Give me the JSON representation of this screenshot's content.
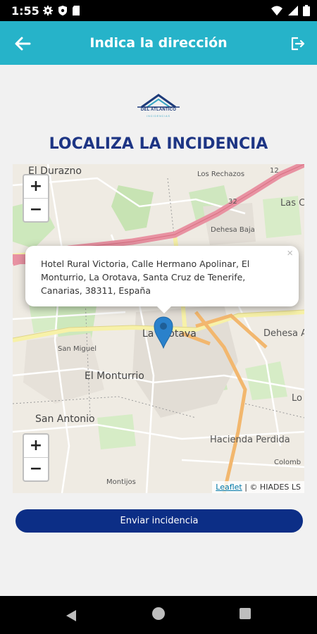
{
  "status_bar": {
    "time": "1:55",
    "icons": [
      "gear-icon",
      "shield-icon",
      "sd-card-icon",
      "wifi-icon",
      "signal-icon",
      "battery-icon"
    ]
  },
  "app_bar": {
    "title": "Indica la dirección",
    "back_icon": "arrow-left-icon",
    "logout_icon": "logout-icon",
    "color": "#26b3c9"
  },
  "logo": {
    "name": "DEL ATLÁNTICO",
    "tagline": "INCIDENCIAS"
  },
  "heading": "LOCALIZA LA INCIDENCIA",
  "map": {
    "labels": {
      "el_durazno": "El Durazno",
      "los_rechazos": "Los Rechazos",
      "las_c": "Las C",
      "dehesa_baja": "Dehesa Baja",
      "la_orotava": "La Orotava",
      "dehesa_a": "Dehesa A",
      "san_miguel": "San Miguel",
      "el_monturrio": "El Monturrio",
      "lo": "Lo",
      "san_antonio": "San Antonio",
      "hacienda_perdida": "Hacienda Perdida",
      "colomba": "Colomb",
      "montijos": "Montijos",
      "route_12": "12",
      "route_32": "32"
    },
    "zoom_in": "+",
    "zoom_out": "−",
    "popup": {
      "text": "Hotel Rural Victoria, Calle Hermano Apolinar, El Monturrio, La Orotava, Santa Cruz de Tenerife, Canarias, 38311, España",
      "close": "×"
    },
    "marker_icon": "map-pin-icon",
    "attribution": {
      "link": "Leaflet",
      "separator": " | ",
      "text": "© HIADES LS"
    }
  },
  "submit_button": "Enviar incidencia",
  "nav_bar": {
    "back_icon": "nav-back-icon",
    "home_icon": "nav-home-icon",
    "recent_icon": "nav-recents-icon"
  }
}
